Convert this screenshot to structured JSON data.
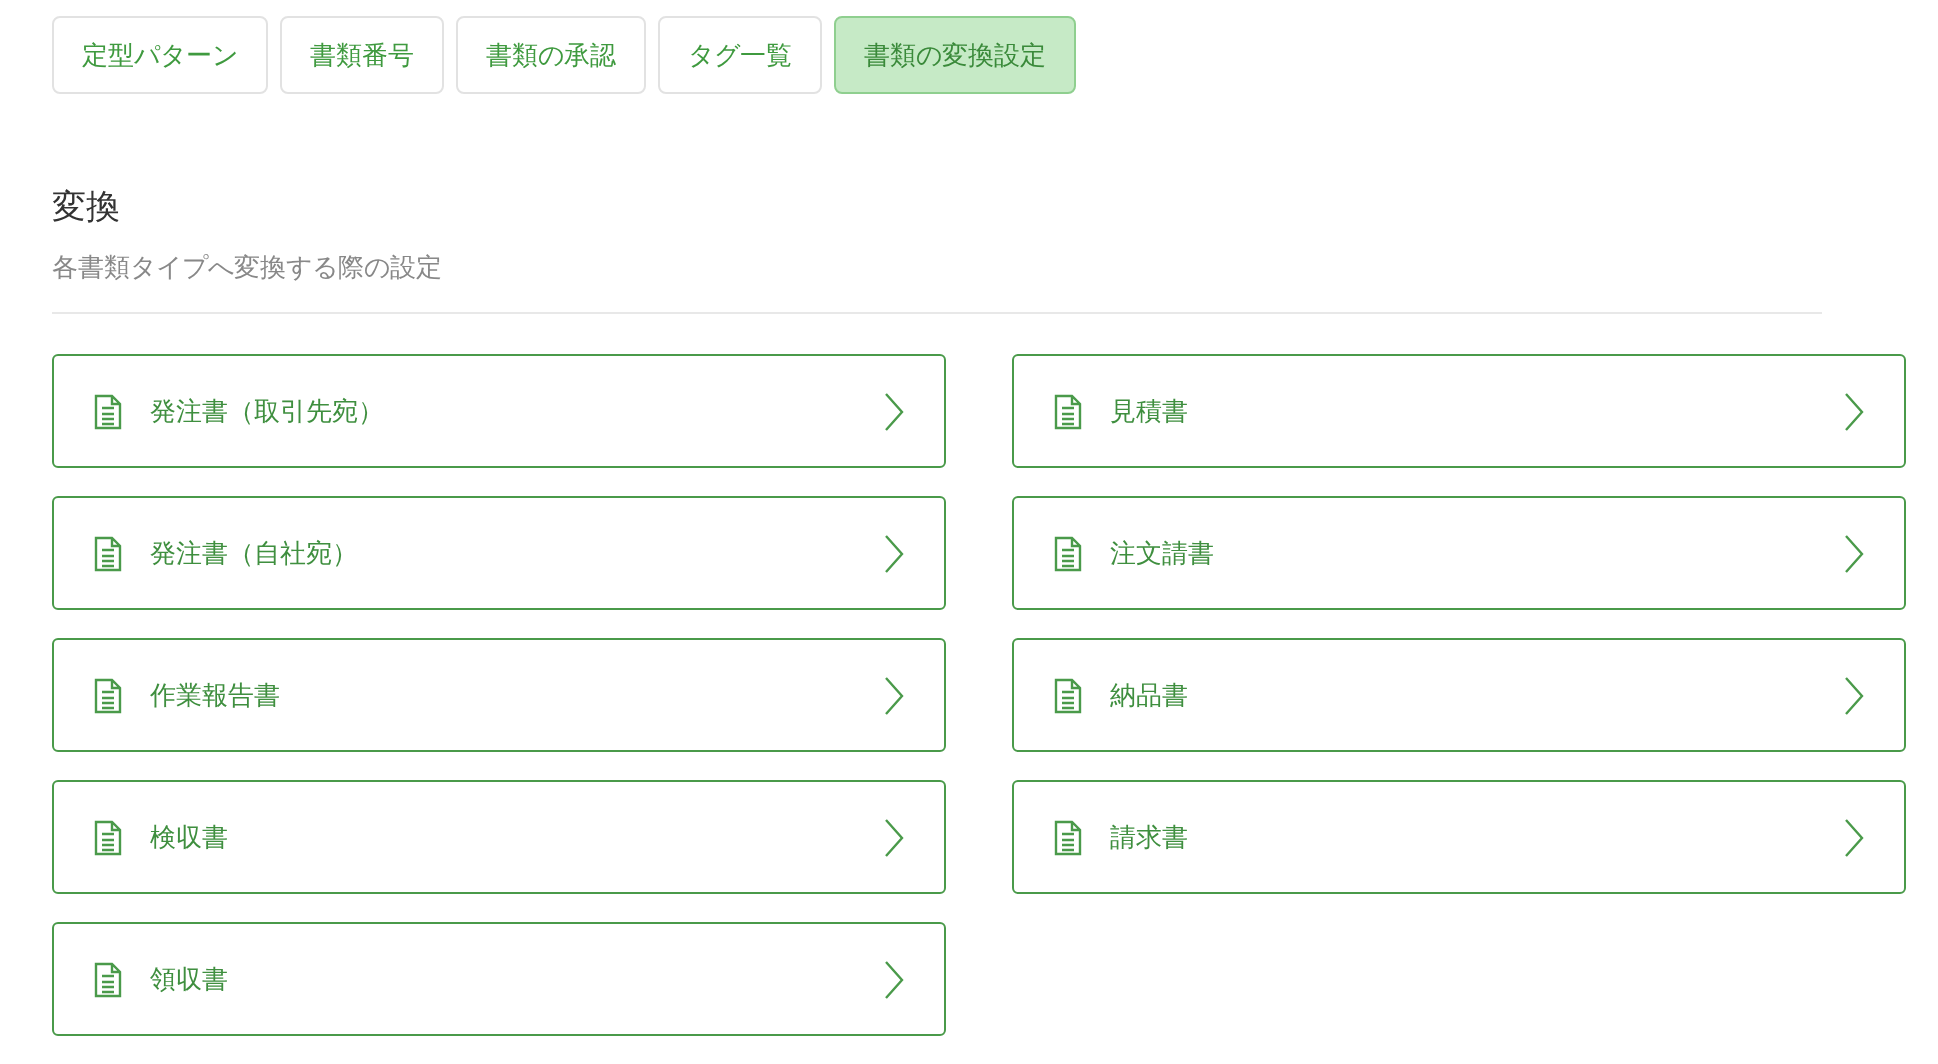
{
  "tabs": [
    {
      "label": "定型パターン",
      "selected": false
    },
    {
      "label": "書類番号",
      "selected": false
    },
    {
      "label": "書類の承認",
      "selected": false
    },
    {
      "label": "タグ一覧",
      "selected": false
    },
    {
      "label": "書類の変換設定",
      "selected": true
    }
  ],
  "section": {
    "title": "変換",
    "description": "各書類タイプへ変換する際の設定"
  },
  "items": [
    {
      "label": "発注書（取引先宛）"
    },
    {
      "label": "見積書"
    },
    {
      "label": "発注書（自社宛）"
    },
    {
      "label": "注文請書"
    },
    {
      "label": "作業報告書"
    },
    {
      "label": "納品書"
    },
    {
      "label": "検収書"
    },
    {
      "label": "請求書"
    },
    {
      "label": "領収書"
    }
  ]
}
